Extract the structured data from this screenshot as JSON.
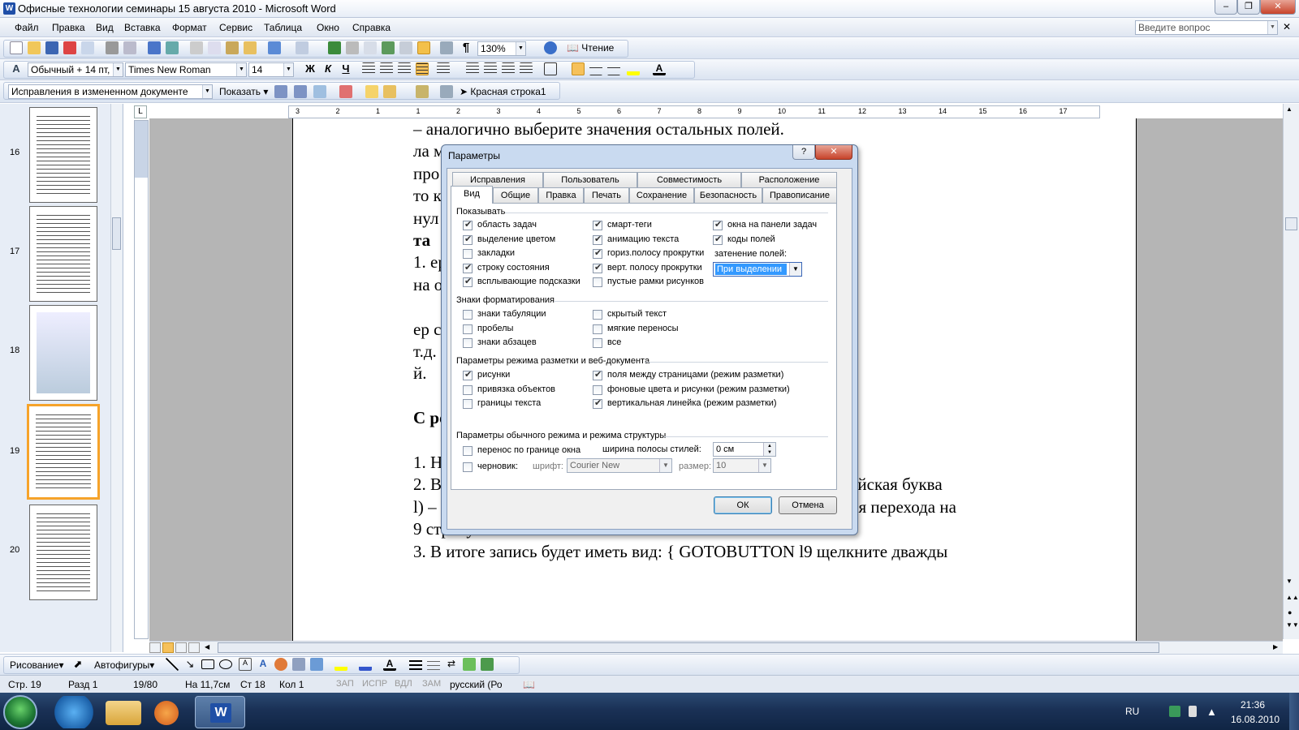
{
  "window": {
    "title": "Офисные технологии семинары 15 августа 2010 - Microsoft Word"
  },
  "menu": {
    "items": [
      "Файл",
      "Правка",
      "Вид",
      "Вставка",
      "Формат",
      "Сервис",
      "Таблица",
      "Окно",
      "Справка"
    ],
    "help_placeholder": "Введите вопрос"
  },
  "standard_toolbar": {
    "zoom": "130%",
    "reading": "Чтение"
  },
  "format_toolbar": {
    "style": "Обычный + 14 пт,",
    "font": "Times New Roman",
    "size": "14",
    "bold": "Ж",
    "italic": "К",
    "underline": "Ч"
  },
  "review_toolbar": {
    "display": "Исправления в измененном документе",
    "show": "Показать",
    "style_name": "Красная строка1"
  },
  "thumbnails": [
    "16",
    "17",
    "18",
    "19",
    "20"
  ],
  "ruler": {
    "ticks": [
      "3",
      "2",
      "1",
      "1",
      "2",
      "3",
      "4",
      "5",
      "6",
      "7",
      "8",
      "9",
      "10",
      "11",
      "12",
      "13",
      "14",
      "15",
      "16",
      "17"
    ]
  },
  "document": {
    "lines": [
      "–  аналогично выберите значения остальных полей.",
      "                                                              ла можно изменить, то",
      "про                                                          в документе не видны,",
      "то                                                          кладка Вид→ выберите",
      "нул                                                          чие полей.",
      "                                                              та",
      "1.                                                           ерехода. В отличии от",
      "                                                              на определенные стра-",
      "",
      "                                                              ер страницы, сноска и",
      "т.д.",
      "                                                              й.",
      "",
      " С                                                           реход в данном доку-",
      "",
      "1.  Нажмите Ctrl+F9.",
      "2.  Введите GOTOBUTTON l9 (перед числом помещена английская буква",
      "l) – переход к 9 строке, далее наберите «щелкните дважды для перехода на",
      "9 строку».",
      "3.  В итоге запись будет иметь вид: { GOTOBUTTON l9 щелкните дважды"
    ]
  },
  "dialog": {
    "title": "Параметры",
    "tabs_row1": [
      "Исправления",
      "Пользователь",
      "Совместимость",
      "Расположение"
    ],
    "tabs_row2": [
      "Вид",
      "Общие",
      "Правка",
      "Печать",
      "Сохранение",
      "Безопасность",
      "Правописание"
    ],
    "show_group": "Показывать",
    "show": {
      "col1": [
        {
          "label": "область задач",
          "on": true
        },
        {
          "label": "выделение цветом",
          "on": true
        },
        {
          "label": "закладки",
          "on": false
        },
        {
          "label": "строку состояния",
          "on": true
        },
        {
          "label": "всплывающие подсказки",
          "on": true
        }
      ],
      "col2": [
        {
          "label": "смарт-теги",
          "on": true
        },
        {
          "label": "анимацию текста",
          "on": true
        },
        {
          "label": "гориз.полосу прокрутки",
          "on": true
        },
        {
          "label": "верт. полосу прокрутки",
          "on": true
        },
        {
          "label": "пустые рамки рисунков",
          "on": false
        }
      ],
      "col3": [
        {
          "label": "окна на панели задач",
          "on": true
        },
        {
          "label": "коды полей",
          "on": true
        }
      ],
      "shading_label": "затенение полей:",
      "shading_value": "При выделении"
    },
    "format_group": "Знаки форматирования",
    "format": {
      "col1": [
        {
          "label": "знаки табуляции",
          "on": false
        },
        {
          "label": "пробелы",
          "on": false
        },
        {
          "label": "знаки абзацев",
          "on": false
        }
      ],
      "col2": [
        {
          "label": "скрытый текст",
          "on": false
        },
        {
          "label": "мягкие переносы",
          "on": false
        },
        {
          "label": "все",
          "on": false
        }
      ]
    },
    "layout_group": "Параметры режима разметки и веб-документа",
    "layout": {
      "col1": [
        {
          "label": "рисунки",
          "on": true
        },
        {
          "label": "привязка объектов",
          "on": false
        },
        {
          "label": "границы текста",
          "on": false
        }
      ],
      "col2": [
        {
          "label": "поля между страницами (режим разметки)",
          "on": true
        },
        {
          "label": "фоновые цвета и рисунки (режим разметки)",
          "on": false
        },
        {
          "label": "вертикальная линейка (режим разметки)",
          "on": true
        }
      ]
    },
    "normal_group": "Параметры обычного режима и режима структуры",
    "normal": {
      "wrap": {
        "label": "перенос по границе окна",
        "on": false
      },
      "draft": {
        "label": "черновик:",
        "on": false
      },
      "style_width_label": "ширина полосы стилей:",
      "style_width_value": "0 см",
      "font_label": "шрифт:",
      "font_value": "Courier New",
      "size_label": "размер:",
      "size_value": "10"
    },
    "ok": "ОК",
    "cancel": "Отмена"
  },
  "drawing_toolbar": {
    "draw": "Рисование",
    "autoshapes": "Автофигуры"
  },
  "status": {
    "page": "Стр. 19",
    "section": "Разд 1",
    "pages": "19/80",
    "at": "На 11,7см",
    "line": "Ст 18",
    "col": "Кол 1",
    "rec": "ЗАП",
    "trk": "ИСПР",
    "ext": "ВДЛ",
    "ovr": "ЗАМ",
    "lang": "русский (Ро"
  },
  "taskbar": {
    "lang": "RU",
    "time": "21:36",
    "date": "16.08.2010"
  },
  "colors": {
    "accent": "#f6a32a",
    "dialog_frame": "#c9daf0",
    "selection": "#3399ff"
  }
}
